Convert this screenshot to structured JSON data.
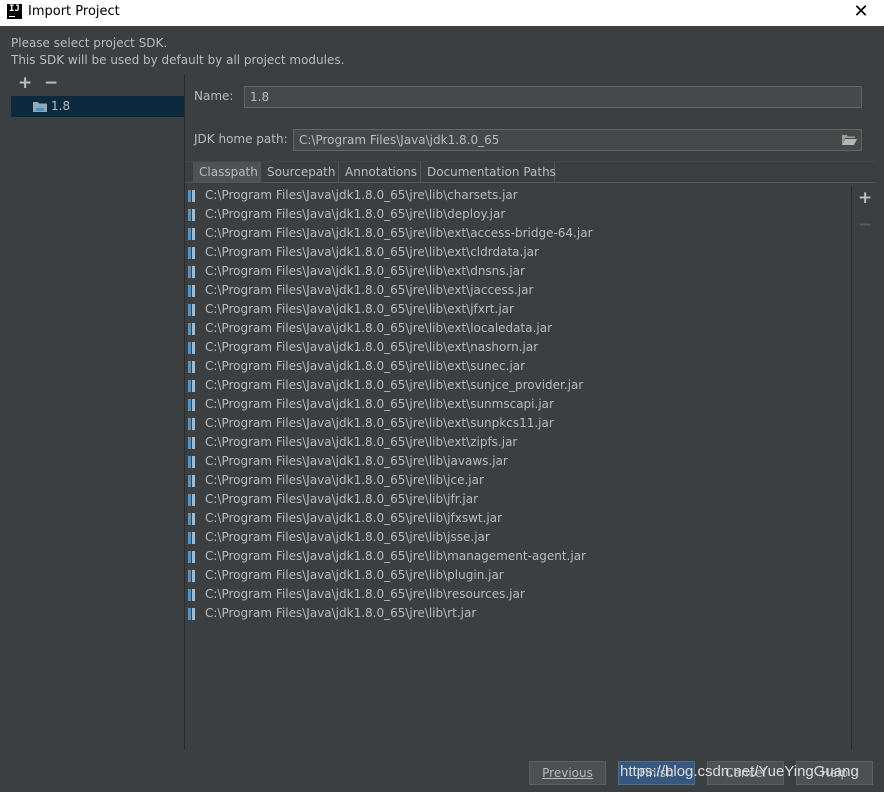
{
  "window": {
    "title": "Import Project",
    "app_icon": "IJ",
    "close": "✕"
  },
  "instructions": {
    "line1": "Please select project SDK.",
    "line2": "This SDK will be used by default by all project modules."
  },
  "sdk_toolbar": {
    "add": "+",
    "remove": "−"
  },
  "sdk_list": {
    "items": [
      {
        "label": "1.8",
        "icon": "folder-icon"
      }
    ]
  },
  "form": {
    "name_label": "Name:",
    "name_value": "1.8",
    "jdk_label": "JDK home path:",
    "jdk_value": "C:\\Program Files\\Java\\jdk1.8.0_65",
    "browse_icon": "folder-open-icon"
  },
  "tabs": [
    {
      "label": "Classpath",
      "active": true
    },
    {
      "label": "Sourcepath",
      "active": false
    },
    {
      "label": "Annotations",
      "active": false
    },
    {
      "label": "Documentation Paths",
      "active": false
    }
  ],
  "classpath": [
    "C:\\Program Files\\Java\\jdk1.8.0_65\\jre\\lib\\charsets.jar",
    "C:\\Program Files\\Java\\jdk1.8.0_65\\jre\\lib\\deploy.jar",
    "C:\\Program Files\\Java\\jdk1.8.0_65\\jre\\lib\\ext\\access-bridge-64.jar",
    "C:\\Program Files\\Java\\jdk1.8.0_65\\jre\\lib\\ext\\cldrdata.jar",
    "C:\\Program Files\\Java\\jdk1.8.0_65\\jre\\lib\\ext\\dnsns.jar",
    "C:\\Program Files\\Java\\jdk1.8.0_65\\jre\\lib\\ext\\jaccess.jar",
    "C:\\Program Files\\Java\\jdk1.8.0_65\\jre\\lib\\ext\\jfxrt.jar",
    "C:\\Program Files\\Java\\jdk1.8.0_65\\jre\\lib\\ext\\localedata.jar",
    "C:\\Program Files\\Java\\jdk1.8.0_65\\jre\\lib\\ext\\nashorn.jar",
    "C:\\Program Files\\Java\\jdk1.8.0_65\\jre\\lib\\ext\\sunec.jar",
    "C:\\Program Files\\Java\\jdk1.8.0_65\\jre\\lib\\ext\\sunjce_provider.jar",
    "C:\\Program Files\\Java\\jdk1.8.0_65\\jre\\lib\\ext\\sunmscapi.jar",
    "C:\\Program Files\\Java\\jdk1.8.0_65\\jre\\lib\\ext\\sunpkcs11.jar",
    "C:\\Program Files\\Java\\jdk1.8.0_65\\jre\\lib\\ext\\zipfs.jar",
    "C:\\Program Files\\Java\\jdk1.8.0_65\\jre\\lib\\javaws.jar",
    "C:\\Program Files\\Java\\jdk1.8.0_65\\jre\\lib\\jce.jar",
    "C:\\Program Files\\Java\\jdk1.8.0_65\\jre\\lib\\jfr.jar",
    "C:\\Program Files\\Java\\jdk1.8.0_65\\jre\\lib\\jfxswt.jar",
    "C:\\Program Files\\Java\\jdk1.8.0_65\\jre\\lib\\jsse.jar",
    "C:\\Program Files\\Java\\jdk1.8.0_65\\jre\\lib\\management-agent.jar",
    "C:\\Program Files\\Java\\jdk1.8.0_65\\jre\\lib\\plugin.jar",
    "C:\\Program Files\\Java\\jdk1.8.0_65\\jre\\lib\\resources.jar",
    "C:\\Program Files\\Java\\jdk1.8.0_65\\jre\\lib\\rt.jar"
  ],
  "classpath_toolbar": {
    "add": "+",
    "remove": "−"
  },
  "buttons": {
    "previous": "Previous",
    "finish": "Finish",
    "cancel": "Cancel",
    "help": "Help"
  },
  "watermark": "https://blog.csdn.net/YueYingGuang",
  "colors": {
    "background": "#3c3f41",
    "selection": "#0d293e",
    "default_button": "#365880",
    "field": "#45494a"
  }
}
